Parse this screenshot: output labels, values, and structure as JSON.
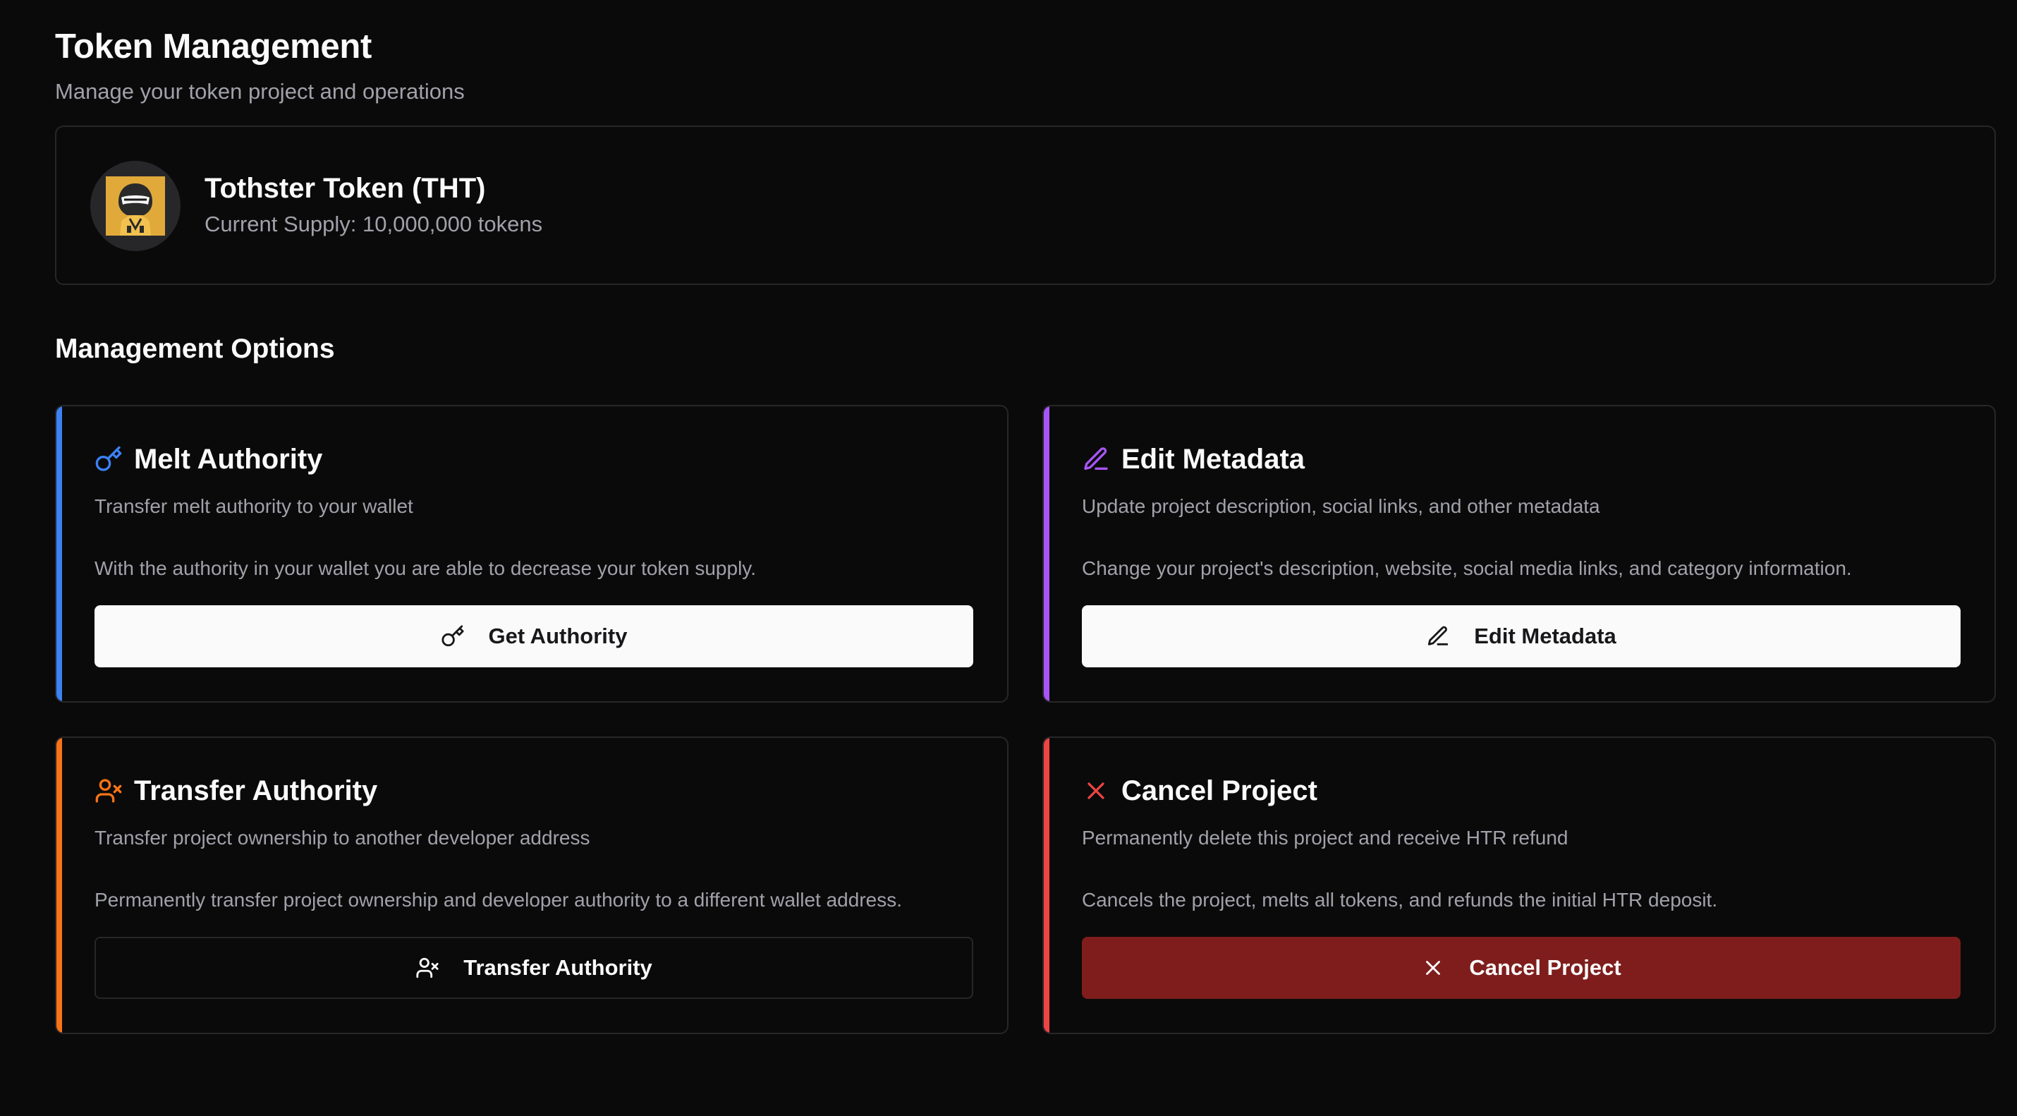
{
  "header": {
    "title": "Token Management",
    "subtitle": "Manage your token project and operations"
  },
  "token": {
    "name": "Tothster Token (THT)",
    "supply": "Current Supply: 10,000,000 tokens",
    "avatar_icon": "helmet-avatar-icon"
  },
  "section": {
    "title": "Management Options"
  },
  "cards": {
    "melt": {
      "icon": "key-icon",
      "accent": "#3b82f6",
      "title": "Melt Authority",
      "subtitle": "Transfer melt authority to your wallet",
      "description": "With the authority in your wallet you are able to decrease your token supply.",
      "button_label": "Get Authority"
    },
    "edit": {
      "icon": "pencil-icon",
      "accent": "#a855f7",
      "title": "Edit Metadata",
      "subtitle": "Update project description, social links, and other metadata",
      "description": "Change your project's description, website, social media links, and category information.",
      "button_label": "Edit Metadata"
    },
    "transfer": {
      "icon": "user-x-icon",
      "accent": "#f97316",
      "title": "Transfer Authority",
      "subtitle": "Transfer project ownership to another developer address",
      "description": "Permanently transfer project ownership and developer authority to a different wallet address.",
      "button_label": "Transfer Authority"
    },
    "cancel": {
      "icon": "close-icon",
      "accent": "#ef4444",
      "title": "Cancel Project",
      "subtitle": "Permanently delete this project and receive HTR refund",
      "description": "Cancels the project, melts all tokens, and refunds the initial HTR deposit.",
      "button_label": "Cancel Project"
    }
  }
}
